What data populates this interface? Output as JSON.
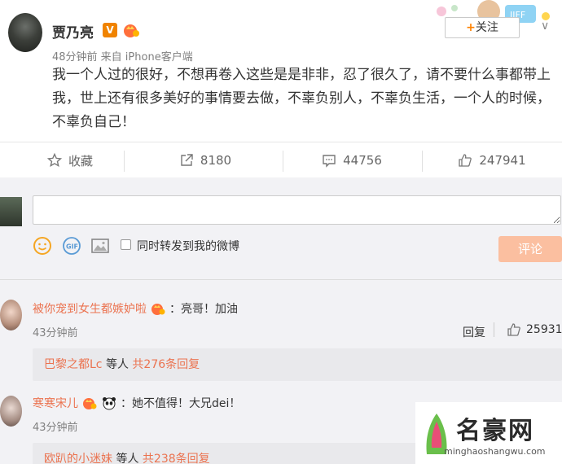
{
  "post": {
    "username": "贾乃亮",
    "verified_badge": "V",
    "meta": "48分钟前 来自 iPhone客户端",
    "follow_label": "关注",
    "follow_plus": "+",
    "text": "我一个人过的很好，不想再卷入这些是是非非，忍了很久了，请不要什么事都带上我，世上还有很多美好的事情要去做，不辜负别人，不辜负生活，一个人的时候，不辜负自己！",
    "dropdown_glyph": "∨"
  },
  "actions": {
    "favorite": {
      "label": "收藏",
      "icon": "star-icon"
    },
    "repost": {
      "count": "8180",
      "icon": "repost-icon"
    },
    "comment": {
      "count": "44756",
      "icon": "comment-icon"
    },
    "like": {
      "count": "247941",
      "icon": "thumbs-up-icon"
    }
  },
  "composer": {
    "placeholder": "",
    "checkbox_label": "同时转发到我的微博",
    "submit_label": "评论",
    "icons": [
      "emoji-icon",
      "gif-icon",
      "image-icon"
    ]
  },
  "comments": [
    {
      "name": "被你宠到女生都嫉妒啦",
      "text": "：亮哥！加油",
      "time": "43分钟前",
      "reply_label": "回复",
      "likes": "25931",
      "sub": {
        "user": "巴黎之都Lc",
        "mid": " 等人 ",
        "count_text": "共276条回复"
      }
    },
    {
      "name": "寒寒宋儿",
      "text": "：她不值得！大兄dei！",
      "time": "43分钟前",
      "sub": {
        "user": "欧趴的小迷妹",
        "mid": " 等人 ",
        "count_text": "共238条回复"
      }
    }
  ],
  "watermark": {
    "title": "名豪网",
    "url": "minghaoshangwu.com"
  },
  "colors": {
    "accent": "#eb7350",
    "orange": "#ff8200",
    "button_disabled": "#fbbfa0"
  }
}
